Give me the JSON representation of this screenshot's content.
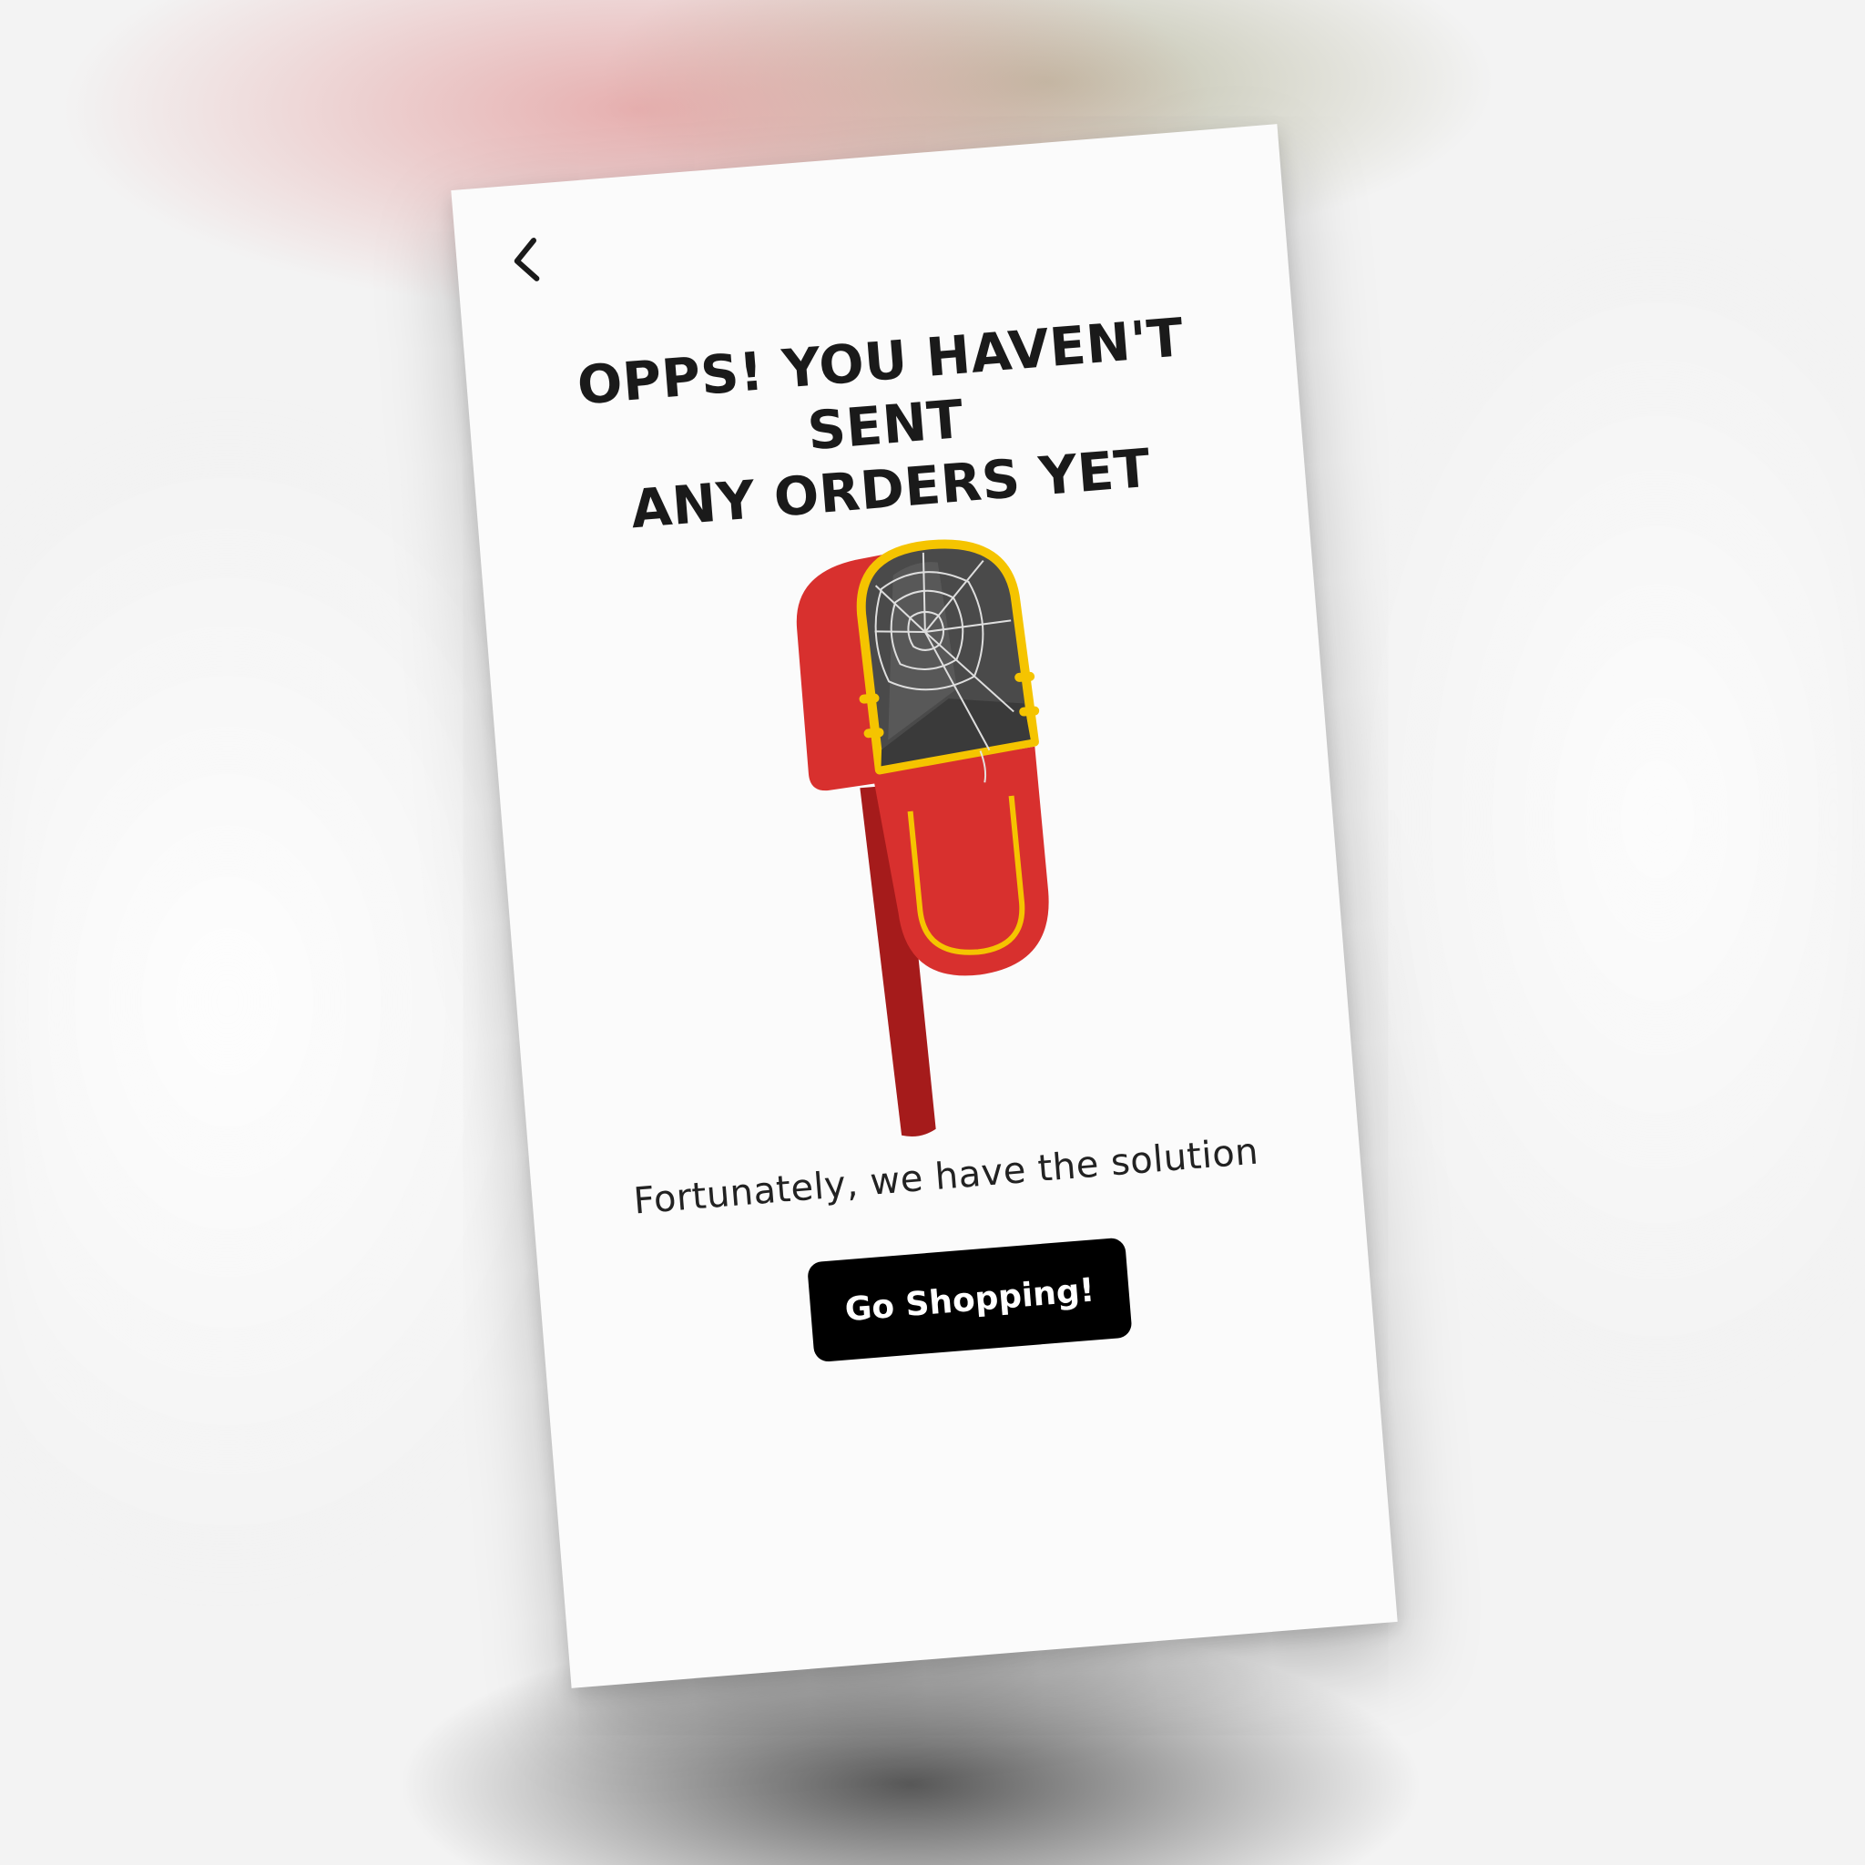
{
  "header": {
    "back_icon": "chevron-left-icon"
  },
  "empty_state": {
    "title_line1": "OPPS! YOU HAVEN'T SENT",
    "title_line2": "ANY ORDERS YET",
    "illustration": "empty-mailbox-with-cobweb",
    "subtitle": "Fortunately, we have the solution",
    "cta_label": "Go Shopping!"
  },
  "colors": {
    "mailbox_red": "#d8302e",
    "mailbox_trim": "#f5c400",
    "post_red": "#a51b1b",
    "cta_bg": "#000000",
    "cta_text": "#ffffff",
    "screen_bg": "#fbfbfb"
  }
}
